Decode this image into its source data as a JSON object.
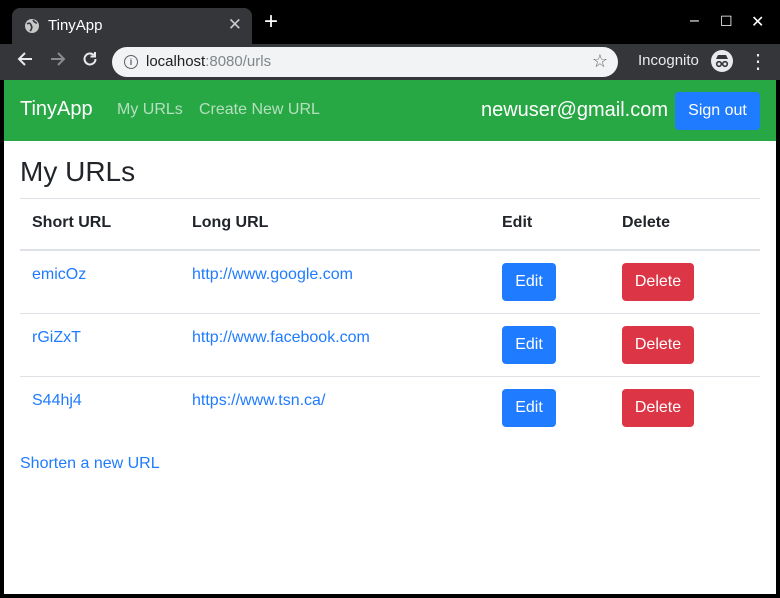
{
  "browser": {
    "tab_title": "TinyApp",
    "tab_close": "✕",
    "new_tab": "+",
    "url_host": "localhost",
    "url_rest": ":8080/urls",
    "incognito_label": "Incognito",
    "window_controls": [
      "–",
      "☐",
      "✕"
    ]
  },
  "navbar": {
    "brand": "TinyApp",
    "links": [
      "My URLs",
      "Create New URL"
    ],
    "user_email": "newuser@gmail.com",
    "signout_label": "Sign out"
  },
  "page": {
    "title": "My URLs",
    "table": {
      "headers": [
        "Short URL",
        "Long URL",
        "Edit",
        "Delete"
      ],
      "rows": [
        {
          "short": "emicOz",
          "long": "http://www.google.com",
          "edit": "Edit",
          "delete": "Delete"
        },
        {
          "short": "rGiZxT",
          "long": "http://www.facebook.com",
          "edit": "Edit",
          "delete": "Delete"
        },
        {
          "short": "S44hj4",
          "long": "https://www.tsn.ca/",
          "edit": "Edit",
          "delete": "Delete"
        }
      ]
    },
    "shorten_link": "Shorten a new URL"
  },
  "colors": {
    "navbar": "#28a745",
    "primary": "#1f7bff",
    "danger": "#dc3545"
  }
}
